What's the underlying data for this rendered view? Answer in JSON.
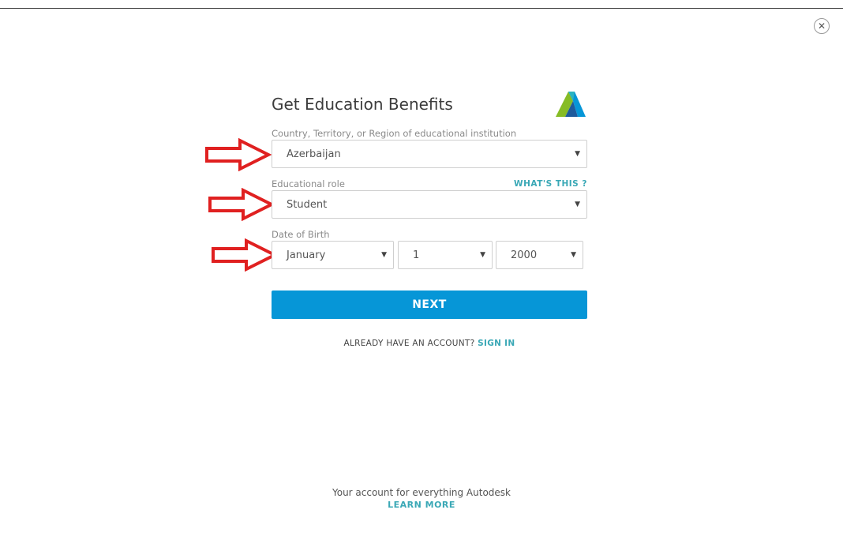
{
  "dialog": {
    "title": "Get Education Benefits",
    "close_icon": "close-icon",
    "logo_icon": "autodesk-logo-icon"
  },
  "country": {
    "label": "Country, Territory, or Region of educational institution",
    "value": "Azerbaijan"
  },
  "role": {
    "label": "Educational role",
    "help_link": "WHAT'S THIS ?",
    "value": "Student"
  },
  "dob": {
    "label": "Date of Birth",
    "month": "January",
    "day": "1",
    "year": "2000"
  },
  "next_button": "NEXT",
  "signin": {
    "prompt": "ALREADY HAVE AN ACCOUNT?",
    "link": "SIGN IN"
  },
  "footer": {
    "text": "Your account for everything Autodesk",
    "link": "LEARN MORE"
  },
  "colors": {
    "accent": "#0696d7",
    "link": "#3aa8b6",
    "annotation_arrow": "#e02020"
  },
  "annotations": [
    "red-arrow-icon",
    "red-arrow-icon",
    "red-arrow-icon"
  ]
}
